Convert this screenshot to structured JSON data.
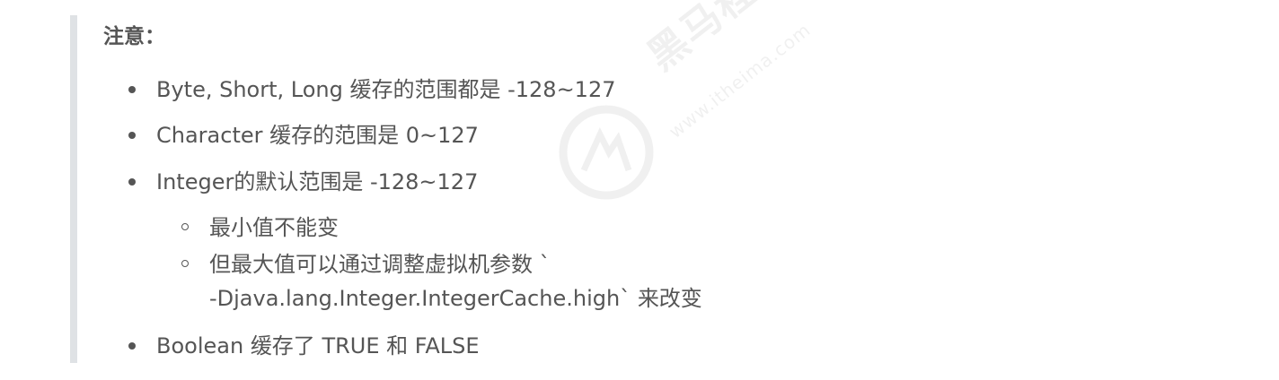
{
  "note": {
    "title": "注意："
  },
  "items": [
    {
      "text": "Byte, Short, Long 缓存的范围都是 -128~127"
    },
    {
      "text": "Character 缓存的范围是 0~127"
    },
    {
      "text": "Integer的默认范围是 -128~127"
    },
    {
      "text": "Boolean 缓存了 TRUE 和 FALSE"
    }
  ],
  "subitems": [
    {
      "text": "最小值不能变"
    },
    {
      "line1": "但最大值可以通过调整虚拟机参数 `",
      "line2": "-Djava.lang.Integer.IntegerCache.high` 来改变"
    }
  ],
  "watermark": {
    "brand": "黑马程序员",
    "url": "www.itheima.com"
  },
  "colors": {
    "text": "#555555",
    "quote_border": "#dfe2e5"
  }
}
